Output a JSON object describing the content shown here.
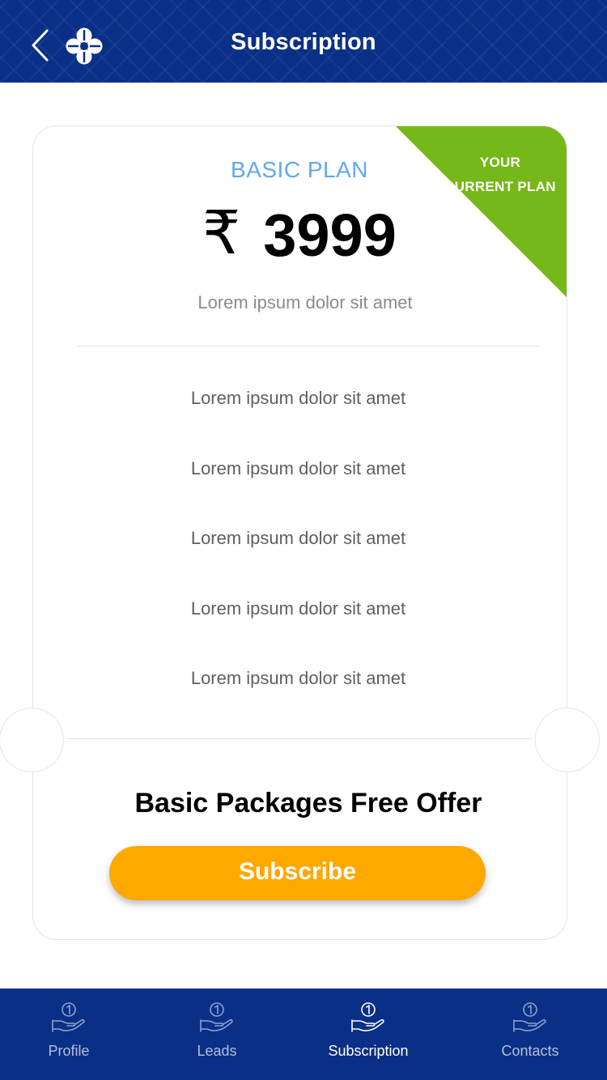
{
  "header": {
    "title": "Subscription"
  },
  "card": {
    "ribbon_text": "YOUR CURRENT PLAN",
    "plan_name": "BASIC PLAN",
    "currency_symbol": "₹",
    "price": "3999",
    "subtitle": "Lorem ipsum dolor sit amet",
    "features": [
      "Lorem ipsum dolor sit amet",
      "Lorem ipsum dolor sit amet",
      "Lorem ipsum dolor sit amet",
      "Lorem ipsum dolor sit amet",
      "Lorem ipsum dolor sit amet"
    ],
    "offer_title": "Basic Packages Free Offer",
    "subscribe_label": "Subscribe"
  },
  "nav": {
    "items": [
      {
        "label": "Profile",
        "icon": "hand-coin-icon",
        "active": false
      },
      {
        "label": "Leads",
        "icon": "hand-coin-icon",
        "active": false
      },
      {
        "label": "Subscription",
        "icon": "hand-coin-icon",
        "active": true
      },
      {
        "label": "Contacts",
        "icon": "hand-coin-icon",
        "active": false
      }
    ]
  },
  "colors": {
    "header_bg": "#0a2f86",
    "ribbon": "#76b81a",
    "plan_name": "#62a8ef",
    "subscribe_button": "#fea800",
    "nav_bg": "#0a2f86"
  }
}
